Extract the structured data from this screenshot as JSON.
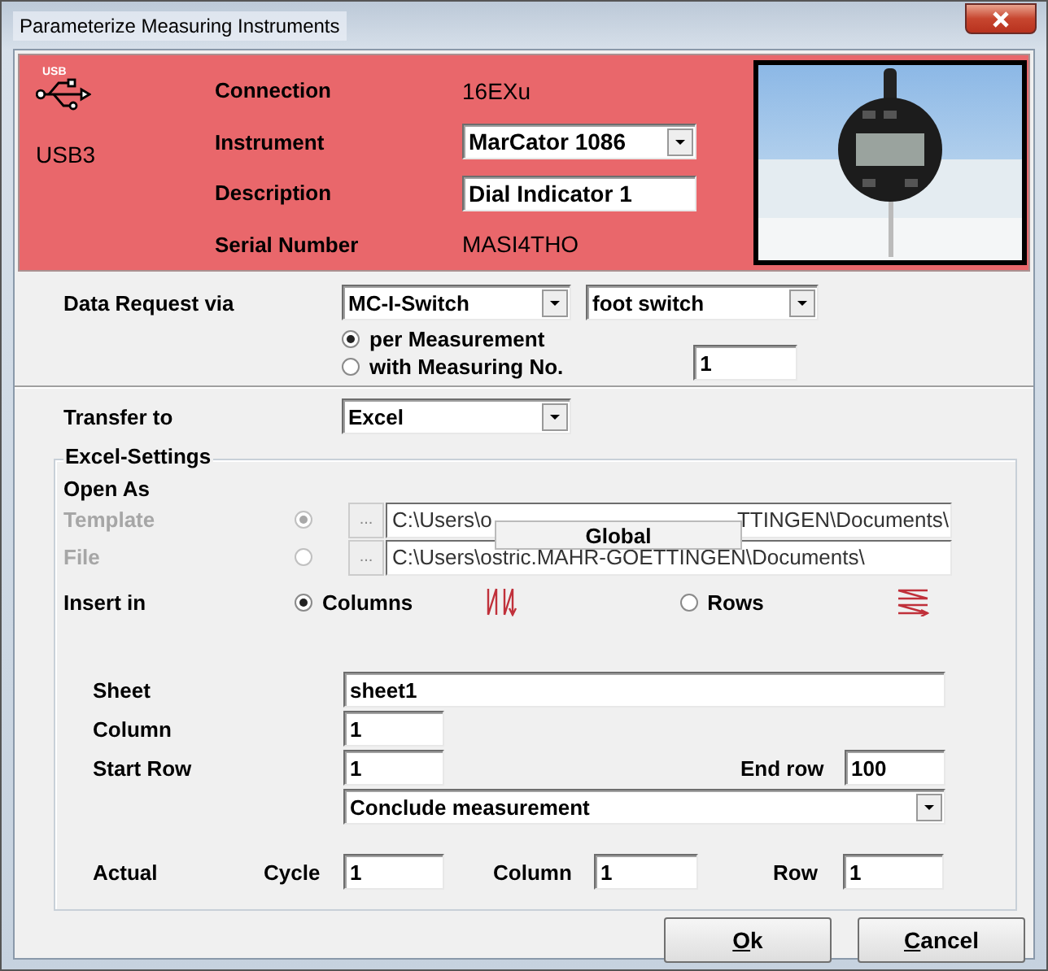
{
  "window": {
    "title": "Parameterize Measuring Instruments"
  },
  "header": {
    "icon_caption": "USB",
    "port": "USB3",
    "fields": [
      {
        "label": "Connection",
        "kind": "text",
        "value": "16EXu"
      },
      {
        "label": "Instrument",
        "kind": "combo",
        "value": "MarCator 1086"
      },
      {
        "label": "Description",
        "kind": "input",
        "value": "Dial Indicator 1"
      },
      {
        "label": "Serial Number",
        "kind": "text",
        "value": "MASI4THO"
      }
    ]
  },
  "data_request": {
    "label": "Data Request via",
    "source": "MC-I-Switch",
    "trigger": "foot switch",
    "modes": [
      {
        "label": "per Measurement",
        "selected": true
      },
      {
        "label": "with Measuring No.",
        "selected": false
      }
    ],
    "measuring_no": "1"
  },
  "transfer": {
    "label": "Transfer to",
    "target": "Excel"
  },
  "excel_settings": {
    "title": "Excel-Settings",
    "open_as_label": "Open As",
    "browse": "...",
    "popup": "Global",
    "open_options": [
      {
        "label": "Template",
        "selected": true,
        "disabled": true,
        "path": [
          "C:\\Users\\o",
          "TTINGEN\\Documents\\"
        ]
      },
      {
        "label": "File",
        "selected": false,
        "disabled": true,
        "path": [
          "C:\\Users\\ostric.MAHR-GOETTINGEN\\Documents\\"
        ]
      }
    ],
    "insert_label": "Insert in",
    "insert_options": [
      {
        "label": "Columns",
        "selected": true,
        "kind": "columns"
      },
      {
        "label": "Rows",
        "selected": false,
        "kind": "rows"
      }
    ],
    "sheet": {
      "label": "Sheet",
      "value": "sheet1"
    },
    "column": {
      "label": "Column",
      "value": "1"
    },
    "start_row": {
      "label": "Start Row",
      "value": "1"
    },
    "end_row": {
      "label": "End row",
      "value": "100"
    },
    "conclude": "Conclude measurement",
    "actual": {
      "label": "Actual",
      "cycle": {
        "label": "Cycle",
        "value": "1"
      },
      "column": {
        "label": "Column",
        "value": "1"
      },
      "row": {
        "label": "Row",
        "value": "1"
      }
    }
  },
  "buttons": [
    {
      "accel": "O",
      "rest": "k"
    },
    {
      "accel": "C",
      "rest": "ancel"
    }
  ]
}
